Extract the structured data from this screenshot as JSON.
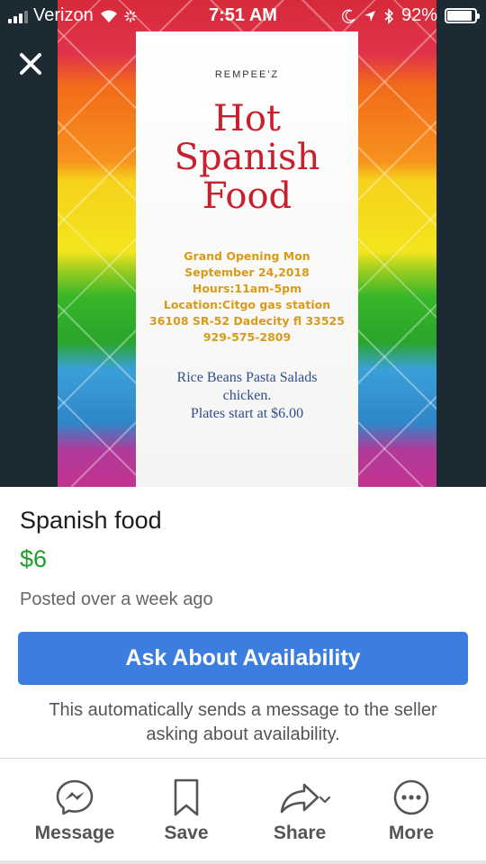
{
  "status_bar": {
    "carrier": "Verizon",
    "time": "7:51 AM",
    "battery": "92%",
    "battery_level": 0.92,
    "icons": [
      "signal-icon",
      "wifi-icon",
      "loading-icon",
      "moon-icon",
      "location-arrow-icon",
      "bluetooth-icon",
      "battery-icon"
    ]
  },
  "flyer": {
    "brand": "REMPEE'Z",
    "title_lines": [
      "Hot",
      "Spanish",
      "Food"
    ],
    "details": [
      "Grand Opening Mon",
      "September 24,2018",
      "Hours:11am-5pm",
      "Location:Citgo gas station",
      "36108 SR-52 Dadecity fl 33525",
      "929-575-2809"
    ],
    "menu": [
      "Rice Beans Pasta Salads",
      "chicken.",
      "Plates start at $6.00"
    ]
  },
  "listing": {
    "title": "Spanish food",
    "price": "$6",
    "posted": "Posted over a week ago",
    "ask_button": "Ask About Availability",
    "note_line1": "This automatically sends a message to the seller",
    "note_line2": "asking about availability."
  },
  "actions": [
    {
      "label": "Message",
      "icon": "messenger-icon"
    },
    {
      "label": "Save",
      "icon": "bookmark-icon"
    },
    {
      "label": "Share",
      "icon": "share-icon"
    },
    {
      "label": "More",
      "icon": "more-icon"
    }
  ],
  "colors": {
    "accent_blue": "#3b7ee0",
    "price_green": "#1e9e2b",
    "flyer_red": "#c8202f",
    "flyer_gold": "#d99a1a",
    "flyer_blue": "#2e4e8a"
  }
}
